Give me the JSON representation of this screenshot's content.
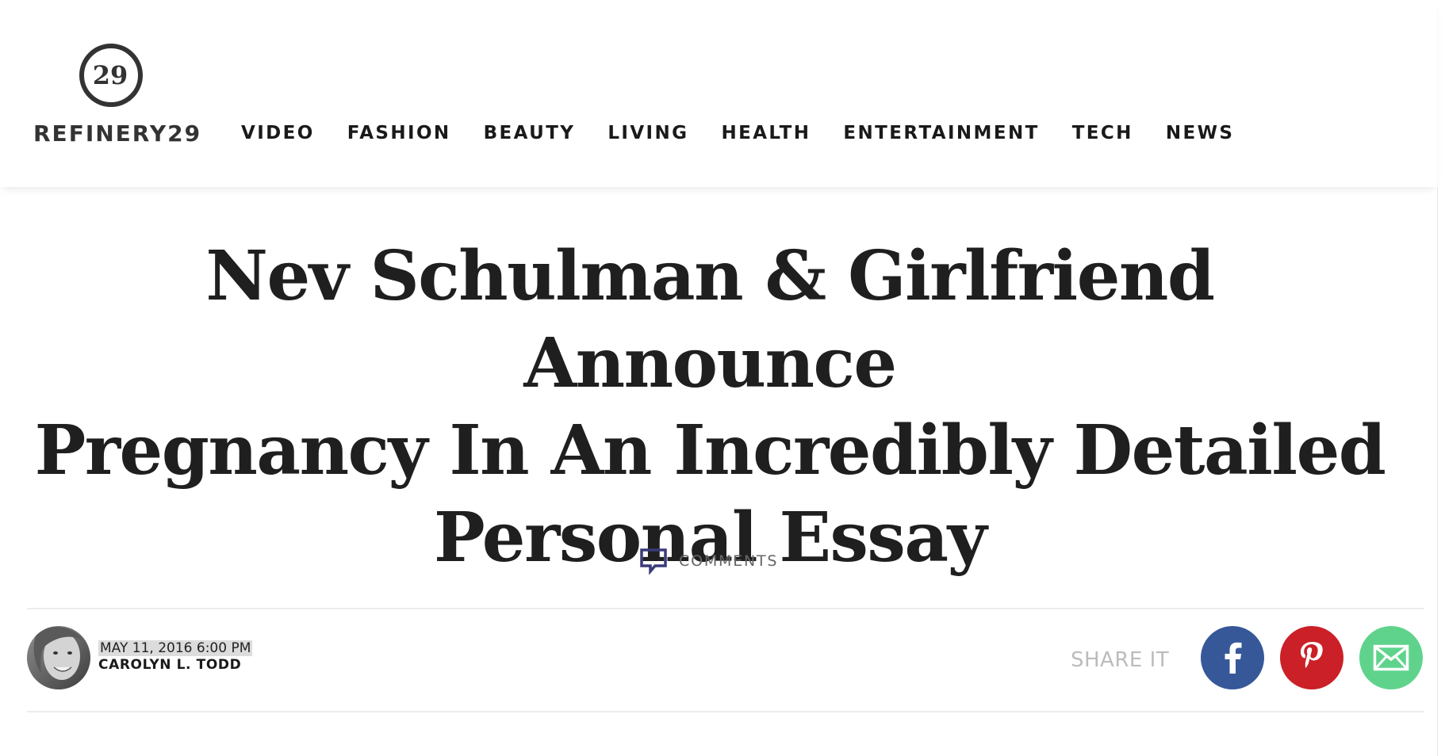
{
  "brand": {
    "name": "REFINERY29",
    "mark": "29"
  },
  "nav": {
    "items": [
      "VIDEO",
      "FASHION",
      "BEAUTY",
      "LIVING",
      "HEALTH",
      "ENTERTAINMENT",
      "TECH",
      "NEWS"
    ]
  },
  "article": {
    "headline_lines": [
      "Nev Schulman & Girlfriend Announce",
      "Pregnancy In An Incredibly Detailed",
      "Personal Essay"
    ],
    "comments_label": "COMMENTS",
    "date": "MAY 11, 2016 6:00 PM",
    "author": "CAROLYN L. TODD"
  },
  "share": {
    "label": "SHARE IT",
    "buttons": [
      {
        "network": "facebook",
        "icon": "facebook-icon",
        "color": "#365899"
      },
      {
        "network": "pinterest",
        "icon": "pinterest-icon",
        "color": "#cb2027"
      },
      {
        "network": "email",
        "icon": "envelope-icon",
        "color": "#5fd38c"
      }
    ]
  },
  "colors": {
    "comments_icon": "#3b3a7a",
    "byline_highlight": "#dcdcdc"
  }
}
